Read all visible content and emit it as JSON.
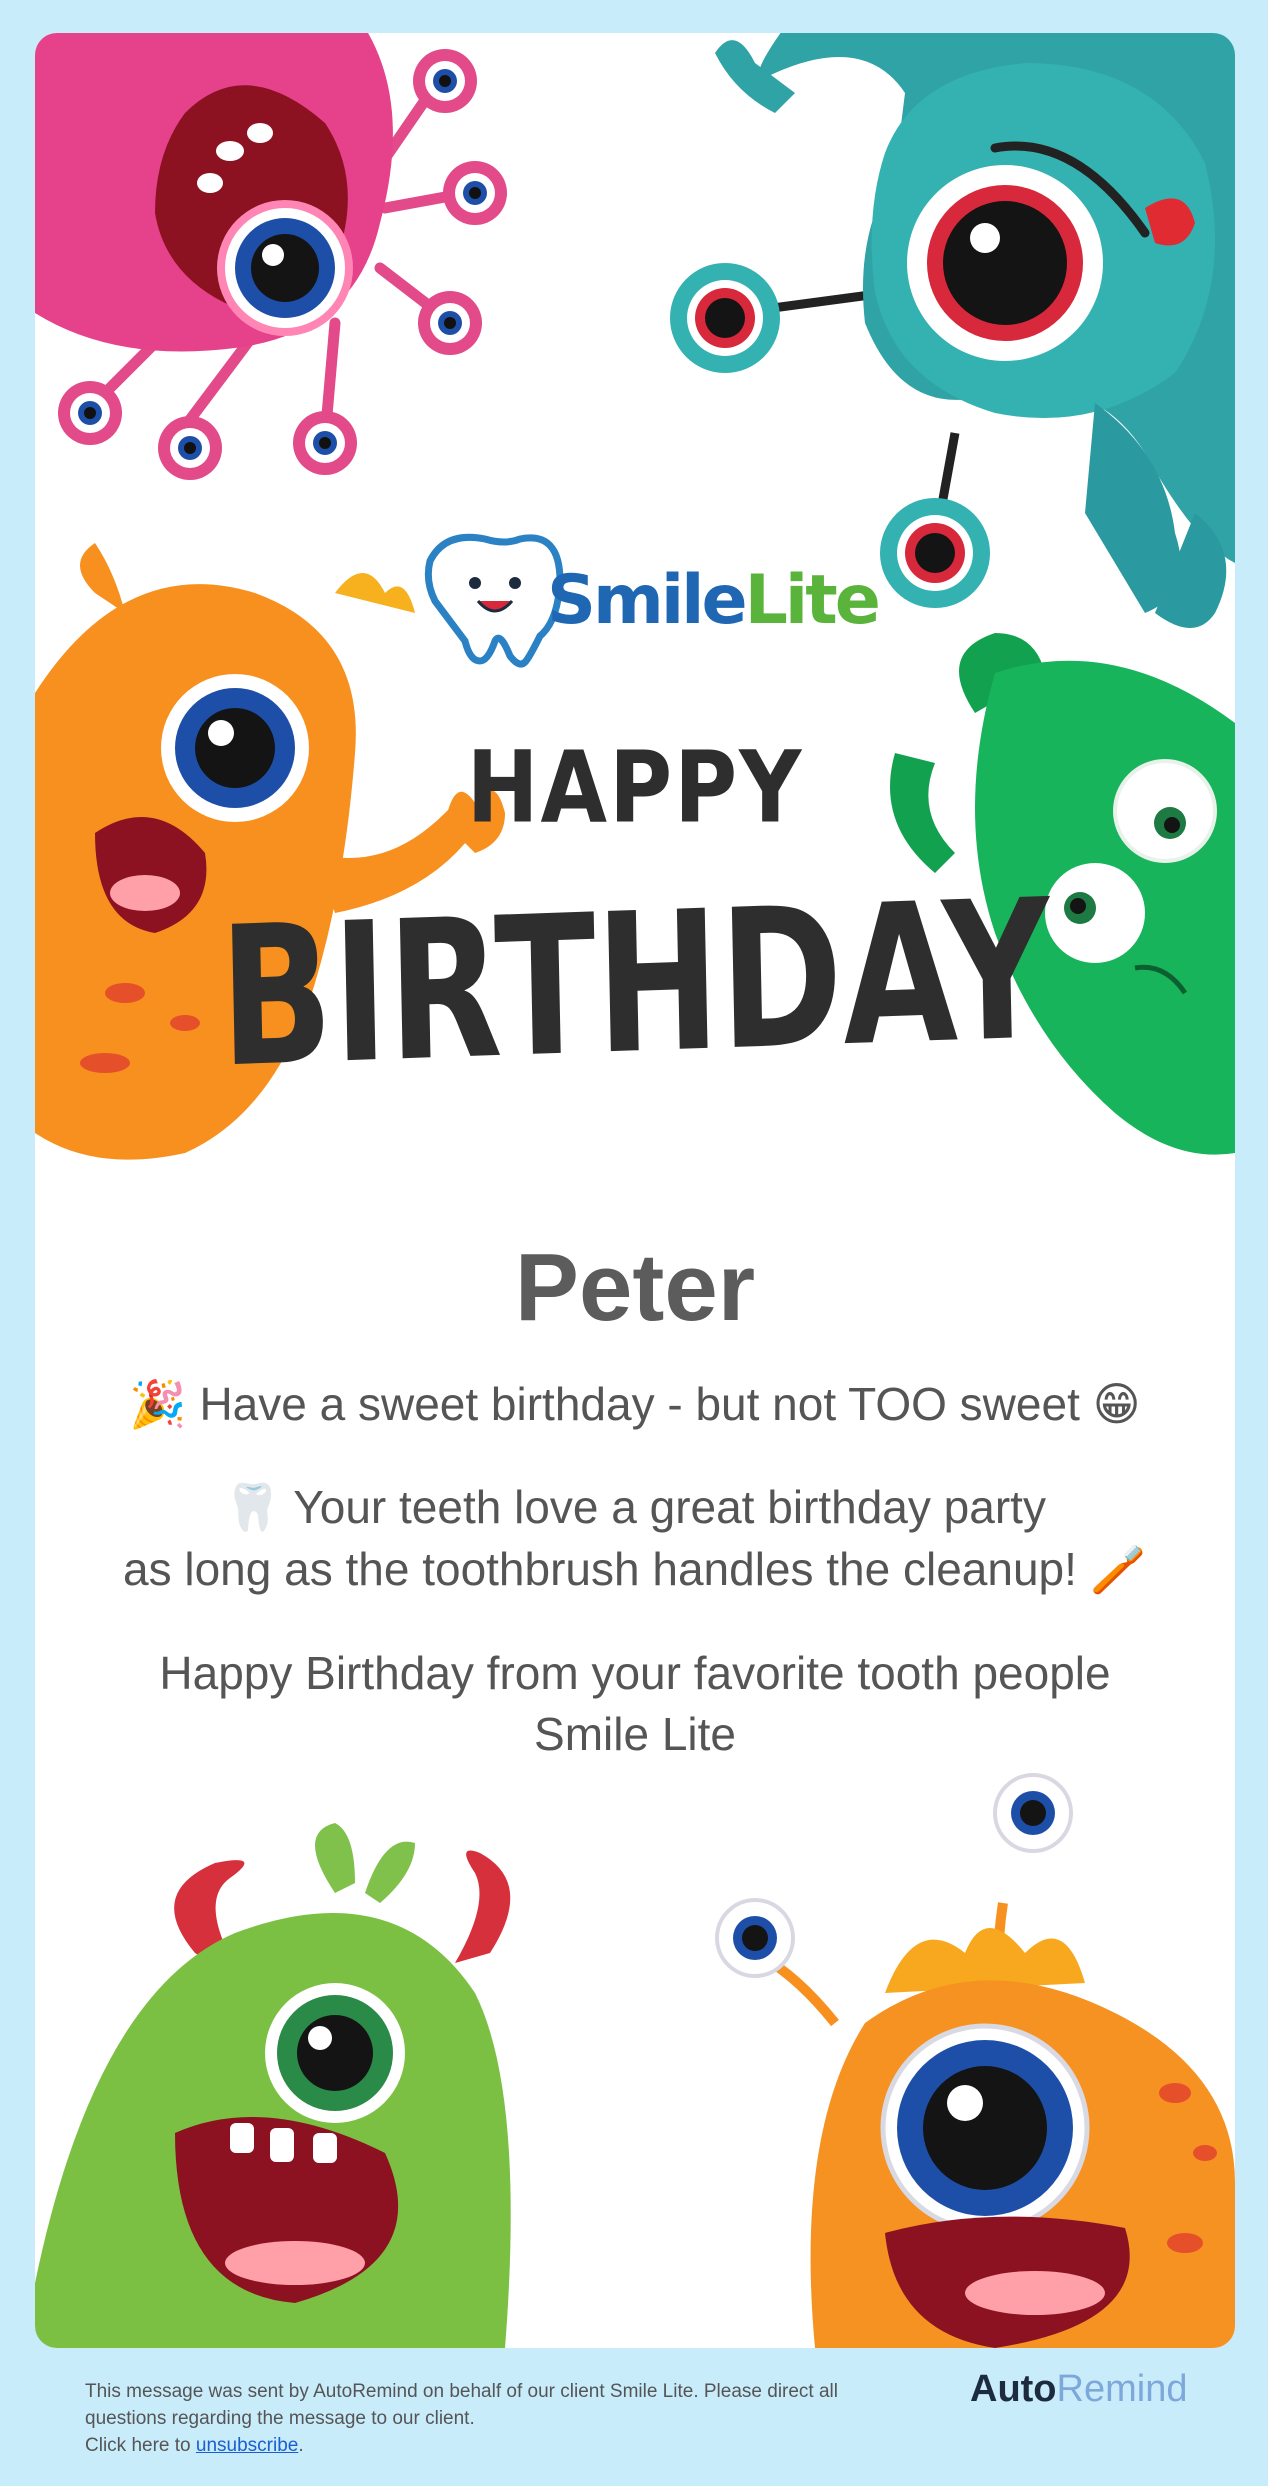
{
  "logo": {
    "brand_word1": "Smile",
    "brand_word2": "Lite"
  },
  "banner": {
    "happy": "HAPPY",
    "birthday": "BIRTHDAY"
  },
  "message": {
    "name": "Peter",
    "line1": "🎉 Have a sweet birthday - but not TOO sweet 😁",
    "line2a": "🦷 Your teeth love a great birthday party",
    "line2b": "as long as the toothbrush handles the cleanup! 🪥",
    "line3a": "Happy Birthday from your favorite tooth people",
    "line3b": "Smile Lite"
  },
  "footer": {
    "line1": "This message was sent by AutoRemind on behalf of our client Smile Lite. Please direct all questions regarding the message to our client.",
    "click_prefix": "Click here to",
    "unsubscribe_label": "unsubscribe",
    "period": ".",
    "brand_word1": "Auto",
    "brand_word2": "Remind"
  },
  "colors": {
    "page_bg": "#c9ecfb",
    "card_bg": "#ffffff",
    "text": "#555555",
    "link": "#1a5fd0",
    "brand_blue": "#1f67b3",
    "brand_green": "#5ab43b"
  },
  "icons": [
    "pink-monster-icon",
    "teal-monster-icon",
    "orange-monster-icon",
    "green-furry-monster-icon",
    "green-horned-monster-icon",
    "orange-antenna-monster-icon",
    "tooth-mascot-icon"
  ]
}
